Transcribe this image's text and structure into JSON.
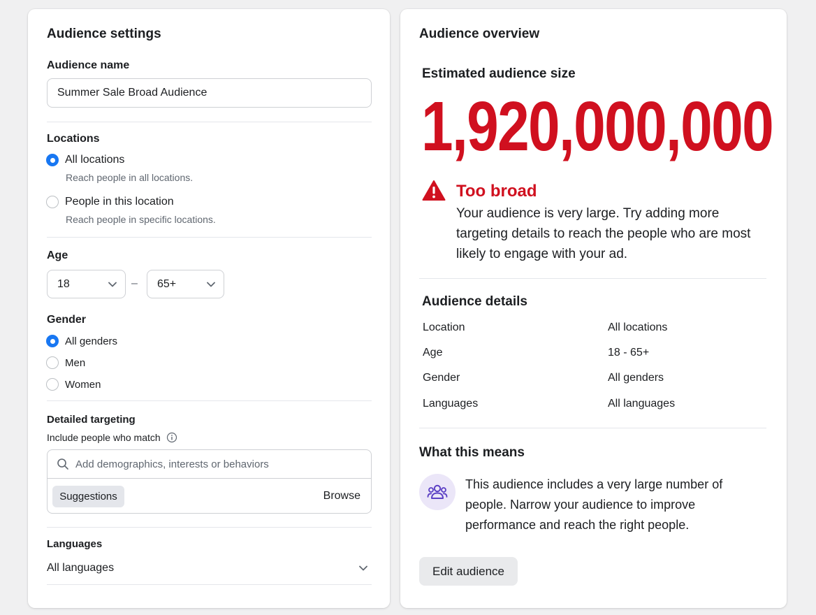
{
  "settings": {
    "title": "Audience settings",
    "audience_name_label": "Audience name",
    "audience_name_value": "Summer Sale Broad Audience",
    "locations": {
      "label": "Locations",
      "options": [
        {
          "label": "All locations",
          "sub": "Reach people in all locations.",
          "selected": true
        },
        {
          "label": "People in this location",
          "sub": "Reach people in specific locations.",
          "selected": false
        }
      ]
    },
    "age": {
      "label": "Age",
      "min": "18",
      "separator": "–",
      "max": "65+"
    },
    "gender": {
      "label": "Gender",
      "options": [
        {
          "label": "All genders",
          "selected": true
        },
        {
          "label": "Men",
          "selected": false
        },
        {
          "label": "Women",
          "selected": false
        }
      ]
    },
    "targeting": {
      "label": "Detailed targeting",
      "sub_label": "Include people who match",
      "search_placeholder": "Add demographics, interests or behaviors",
      "suggestions_label": "Suggestions",
      "browse_label": "Browse"
    },
    "languages": {
      "label": "Languages",
      "value": "All languages"
    }
  },
  "overview": {
    "title": "Audience overview",
    "estimate_label": "Estimated audience size",
    "estimate_value": "1,920,000,000",
    "warning": {
      "title": "Too broad",
      "body": "Your audience is very large. Try adding more targeting details to reach the people who are most likely to engage with your ad."
    },
    "details": {
      "title": "Audience details",
      "rows": [
        {
          "key": "Location",
          "value": "All locations"
        },
        {
          "key": "Age",
          "value": "18 - 65+"
        },
        {
          "key": "Gender",
          "value": "All genders"
        },
        {
          "key": "Languages",
          "value": "All languages"
        }
      ]
    },
    "means": {
      "title": "What this means",
      "body": "This audience includes a very large number of people. Narrow your audience to improve performance and reach the right people."
    },
    "edit_button": "Edit audience"
  },
  "icons": {
    "warning": "warning-triangle-icon",
    "people": "people-group-icon",
    "search": "search-icon",
    "info": "info-icon",
    "chevron": "chevron-down-icon"
  },
  "colors": {
    "accent": "#1877f2",
    "danger": "#d0101f",
    "people_icon_bg": "#ebe6f8",
    "people_icon": "#5b3fc4"
  }
}
